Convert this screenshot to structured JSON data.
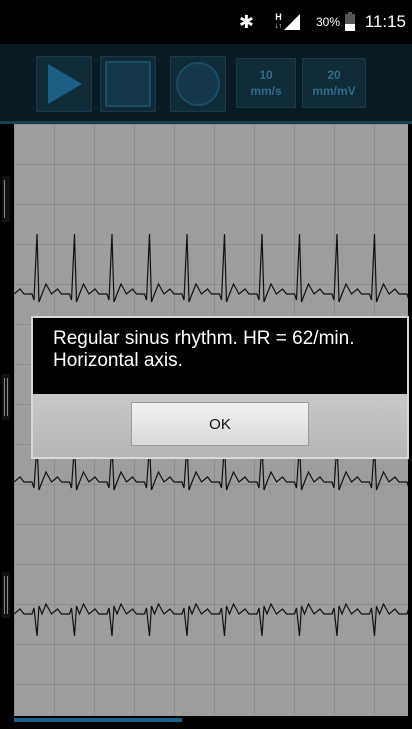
{
  "status_bar": {
    "time": "11:15",
    "battery_percent": "30%",
    "network_label": "H",
    "bluetooth_icon": "bluetooth-icon",
    "signal_icon": "signal-icon",
    "battery_icon": "battery-icon"
  },
  "toolbar": {
    "play_icon": "play-icon",
    "stop_icon": "stop-icon",
    "record_icon": "record-icon",
    "speed_value": "10",
    "speed_unit": "mm/s",
    "gain_value": "20",
    "gain_unit": "mm/mV",
    "accent_color": "#1d5f86"
  },
  "ecg": {
    "leads": [
      {
        "marker_icon": "calibration-marker-icon"
      },
      {
        "marker_icon": "calibration-marker-icon"
      },
      {
        "marker_icon": "calibration-marker-icon"
      }
    ]
  },
  "dialog": {
    "message_line1": "Regular sinus rhythm. HR = 62/min.",
    "message_line2": "Horizontal axis.",
    "ok_label": "OK"
  }
}
